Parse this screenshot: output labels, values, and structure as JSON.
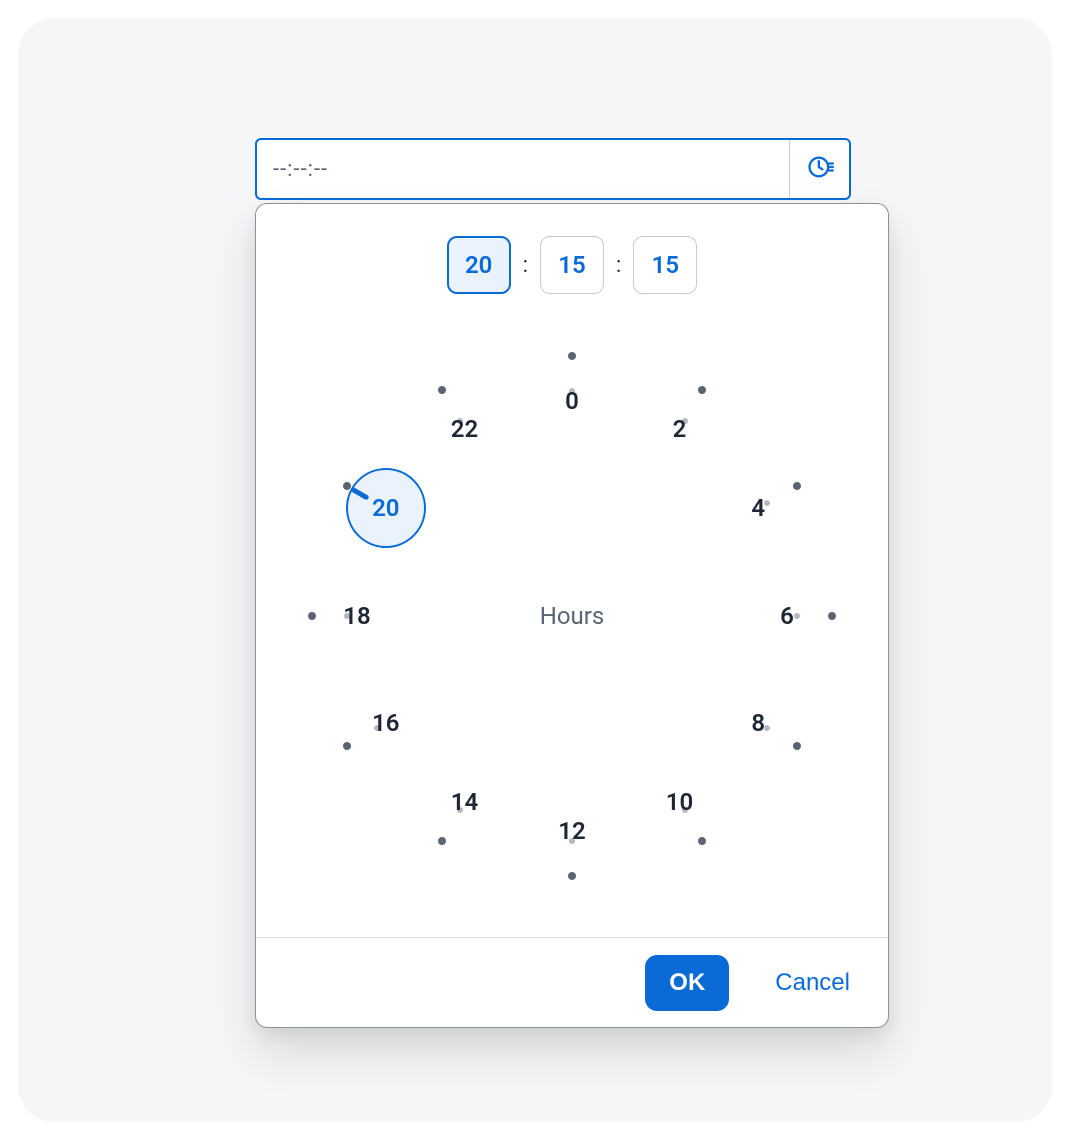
{
  "input": {
    "value": "--:--:--"
  },
  "segments": {
    "hours": "20",
    "minutes": "15",
    "seconds": "15",
    "separator": ":"
  },
  "clock": {
    "center_label": "Hours",
    "selected_value": "20",
    "selected_index": 10,
    "hours": [
      "0",
      "2",
      "4",
      "6",
      "8",
      "10",
      "12",
      "14",
      "16",
      "18",
      "20",
      "22"
    ]
  },
  "footer": {
    "ok": "OK",
    "cancel": "Cancel"
  }
}
